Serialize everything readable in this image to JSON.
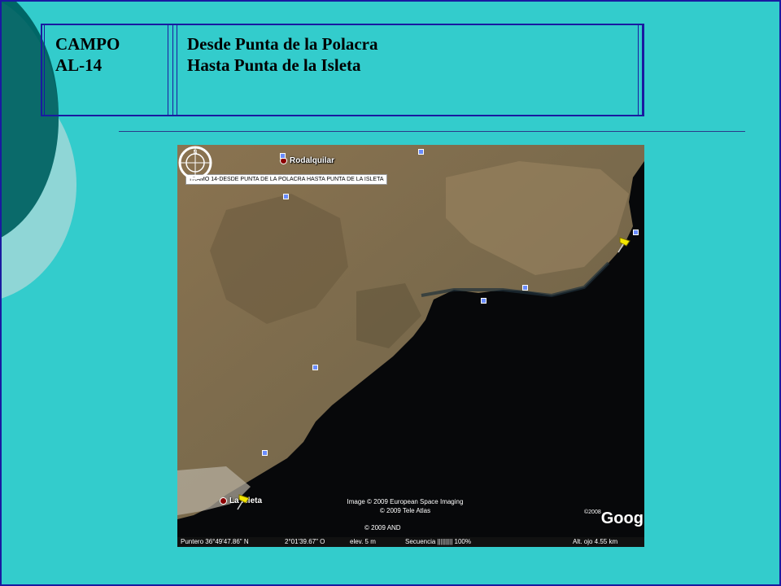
{
  "slide": {
    "title_left": [
      "CAMPO",
      "AL-14"
    ],
    "title_right": [
      "Desde Punta de la Polacra",
      "Hasta Punta de la Isleta"
    ],
    "colors": {
      "background": "#33CCCC",
      "border": "#1a1aa0",
      "circle_dark": "#006666",
      "circle_light": "#8fd6d6"
    }
  },
  "map": {
    "tramo_label": "TRAMO 14-DESDE PUNTA DE LA POLACRA HASTA PUNTA DE LA ISLETA",
    "places": {
      "north": "Rodalquilar",
      "south": "La Isleta"
    },
    "credits": [
      "Image © 2009 European Space Imaging",
      "© 2009 Tele Atlas",
      "© 2009 AND"
    ],
    "logo": "Google",
    "logo_year": "©2008",
    "compass_letter": "N",
    "status": {
      "pointer": "Puntero  36°49'47.86\" N",
      "lon": "2°01'39.67\" O",
      "elev": "elev.     5 m",
      "stream": "Secuencia ||||||||| 100%",
      "eye": "Alt. ojo    4.55 km"
    }
  }
}
